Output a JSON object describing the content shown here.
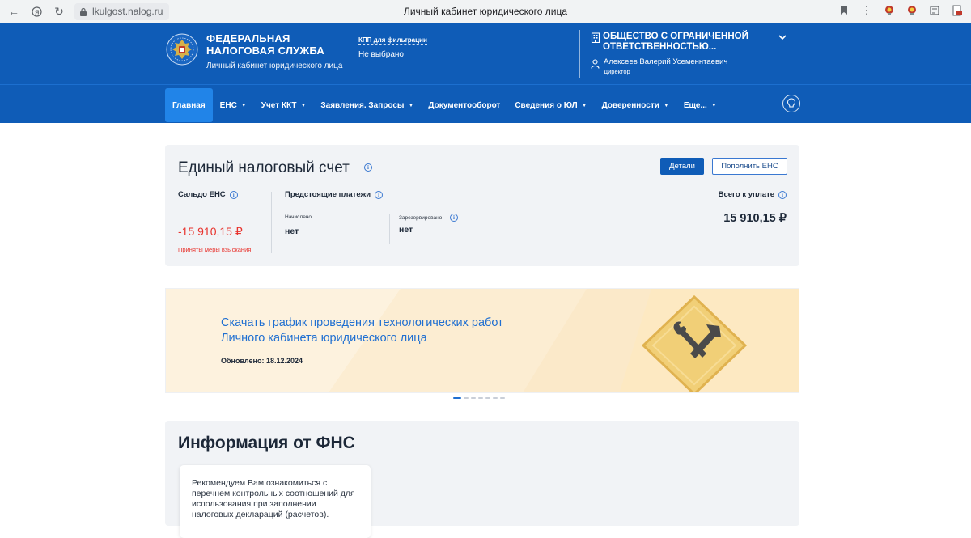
{
  "browser": {
    "url": "lkulgost.nalog.ru",
    "page_title": "Личный кабинет юридического лица"
  },
  "header": {
    "org_line1": "ФЕДЕРАЛЬНАЯ",
    "org_line2": "НАЛОГОВАЯ СЛУЖБА",
    "org_subtitle": "Личный кабинет юридического лица",
    "kpp_label": "КПП для фильтрации",
    "kpp_value": "Не выбрано",
    "company_name": "ОБЩЕСТВО С ОГРАНИЧЕННОЙ ОТВЕТСТВЕННОСТЬЮ...",
    "person_name": "Алексеев Валерий Усеменнтаевич",
    "person_role": "Директор"
  },
  "nav": {
    "items": [
      {
        "label": "Главная",
        "dropdown": false,
        "active": true
      },
      {
        "label": "ЕНС",
        "dropdown": true
      },
      {
        "label": "Учет ККТ",
        "dropdown": true
      },
      {
        "label": "Заявления. Запросы",
        "dropdown": true
      },
      {
        "label": "Документооборот",
        "dropdown": false
      },
      {
        "label": "Сведения о ЮЛ",
        "dropdown": true
      },
      {
        "label": "Доверенности",
        "dropdown": true
      },
      {
        "label": "Еще...",
        "dropdown": true
      }
    ]
  },
  "ens": {
    "title": "Единый налоговый счет",
    "details_button": "Детали",
    "topup_button": "Пополнить ЕНС",
    "saldo_label": "Сальдо ЕНС",
    "saldo_value": "-15 910,15 ₽",
    "saldo_note": "Приняты меры взыскания",
    "upcoming_label": "Предстоящие платежи",
    "accrued_label": "Начислено",
    "accrued_value": "нет",
    "reserved_label": "Зарезервировано",
    "reserved_value": "нет",
    "total_label": "Всего к уплате",
    "total_value": "15 910,15 ₽"
  },
  "banner": {
    "title_line1": "Скачать график проведения технологических работ",
    "title_line2": "Личного кабинета юридического лица",
    "updated": "Обновлено: 18.12.2024",
    "slide_count": 7,
    "active_slide": 1
  },
  "info": {
    "title": "Информация от ФНС",
    "card_text": "Рекомендуем Вам ознакомиться с перечнем контрольных соотношений для использования при заполнении налоговых деклараций (расчетов)."
  },
  "colors": {
    "brand_blue": "#0f5cb7",
    "active_nav": "#2184e8",
    "negative_red": "#e8332d",
    "link_blue": "#1f6fd1"
  }
}
